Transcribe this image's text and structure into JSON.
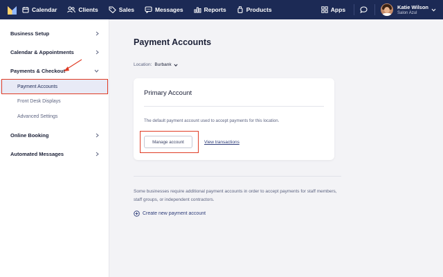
{
  "nav": {
    "items": [
      {
        "label": "Calendar",
        "icon": "calendar-icon"
      },
      {
        "label": "Clients",
        "icon": "clients-icon"
      },
      {
        "label": "Sales",
        "icon": "tag-icon"
      },
      {
        "label": "Messages",
        "icon": "message-icon"
      },
      {
        "label": "Reports",
        "icon": "bar-chart-icon"
      },
      {
        "label": "Products",
        "icon": "products-icon"
      }
    ],
    "apps_label": "Apps",
    "user_name": "Katie Wilson",
    "salon_name": "Salon Azul"
  },
  "sidebar": {
    "items": [
      {
        "label": "Business Setup"
      },
      {
        "label": "Calendar & Appointments"
      },
      {
        "label": "Payments & Checkout"
      },
      {
        "label": "Online Booking"
      },
      {
        "label": "Automated Messages"
      }
    ],
    "sub_items": [
      {
        "label": "Payment Accounts"
      },
      {
        "label": "Front Desk Displays"
      },
      {
        "label": "Advanced Settings"
      }
    ]
  },
  "main": {
    "title": "Payment Accounts",
    "location_label": "Location:",
    "location_value": "Burbank",
    "card": {
      "title": "Primary Account",
      "description": "The default payment account used to accept payments for this location.",
      "manage_button": "Manage account",
      "view_link": "View transactions"
    },
    "note": "Some businesses require additional payment accounts in order to accept payments for staff members, staff groups, or independent contractors.",
    "add_link": "Create new payment account"
  },
  "colors": {
    "nav_bg": "#1c2a55",
    "highlight": "#e03b24",
    "link": "#2b3a78",
    "active_bg": "#e8eaf6"
  }
}
